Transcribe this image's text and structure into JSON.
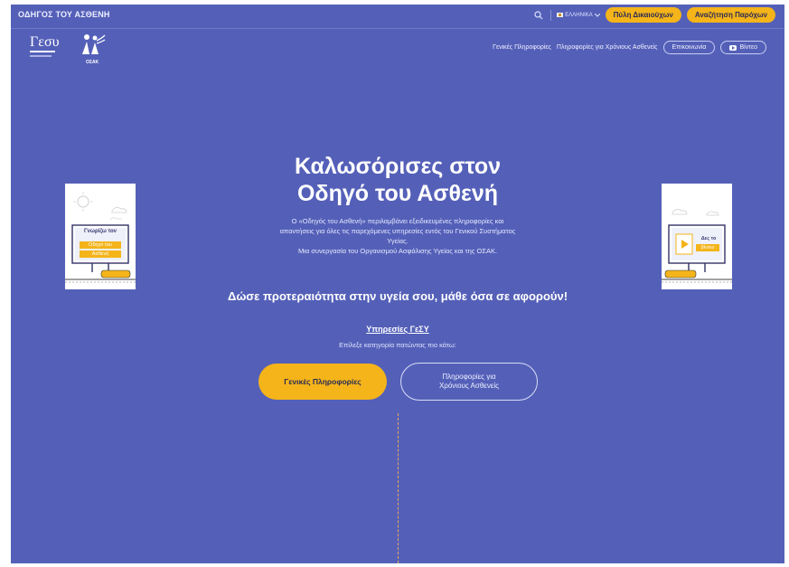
{
  "topbar": {
    "site_title": "ΟΔΗΓΟΣ ΤΟΥ ΑΣΘΕΝΗ",
    "language": "ΕΛΛΗΝΙΚΑ",
    "portal_button": "Πύλη Δικαιούχων",
    "search_providers_button": "Αναζήτηση Παρόχων"
  },
  "logos": {
    "gesy": "Γεσυ",
    "osak": "ΟΣΑΚ"
  },
  "nav": {
    "items": [
      "Γενικές Πληροφορίες",
      "Πληροφορίες για Χρόνιους Ασθενείς"
    ],
    "contact": "Επικοινωνία",
    "video": "Βίντεο"
  },
  "hero": {
    "title_line1": "Καλωσόρισες στον",
    "title_line2": "Οδηγό του Ασθενή",
    "desc_line1": "Ο «Οδηγός του Ασθενή» περιλαμβάνει εξειδικευμένες πληροφορίες και",
    "desc_line2": "απαντήσεις για όλες τις παρεχόμενες υπηρεσίες εντός του Γενικού Συστήματος",
    "desc_line3": "Υγείας.",
    "desc_line4": "Μια συνεργασία του Οργανισμού Ασφάλισης Υγείας και της ΟΣΑΚ.",
    "tagline": "Δώσε προτεραιότητα στην υγεία σου, μάθε όσα σε αφορούν!",
    "services_link": "Υπηρεσίες ΓεΣΥ",
    "services_sub": "Επίλεξε κατηγορία πατώντας πιο κάτω:",
    "btn_general": "Γενικές Πληροφορίες",
    "btn_chronic_line1": "Πληροφορίες για",
    "btn_chronic_line2": "Χρόνιους Ασθενείς"
  },
  "cards": {
    "left_line1": "Γνωρίζω τον",
    "left_line2": "Οδηγό του",
    "left_line3": "Ασθενή",
    "right_line1": "Δες το",
    "right_line2": "βίντεο"
  },
  "colors": {
    "background": "#5460b8",
    "accent": "#f4b41a"
  }
}
